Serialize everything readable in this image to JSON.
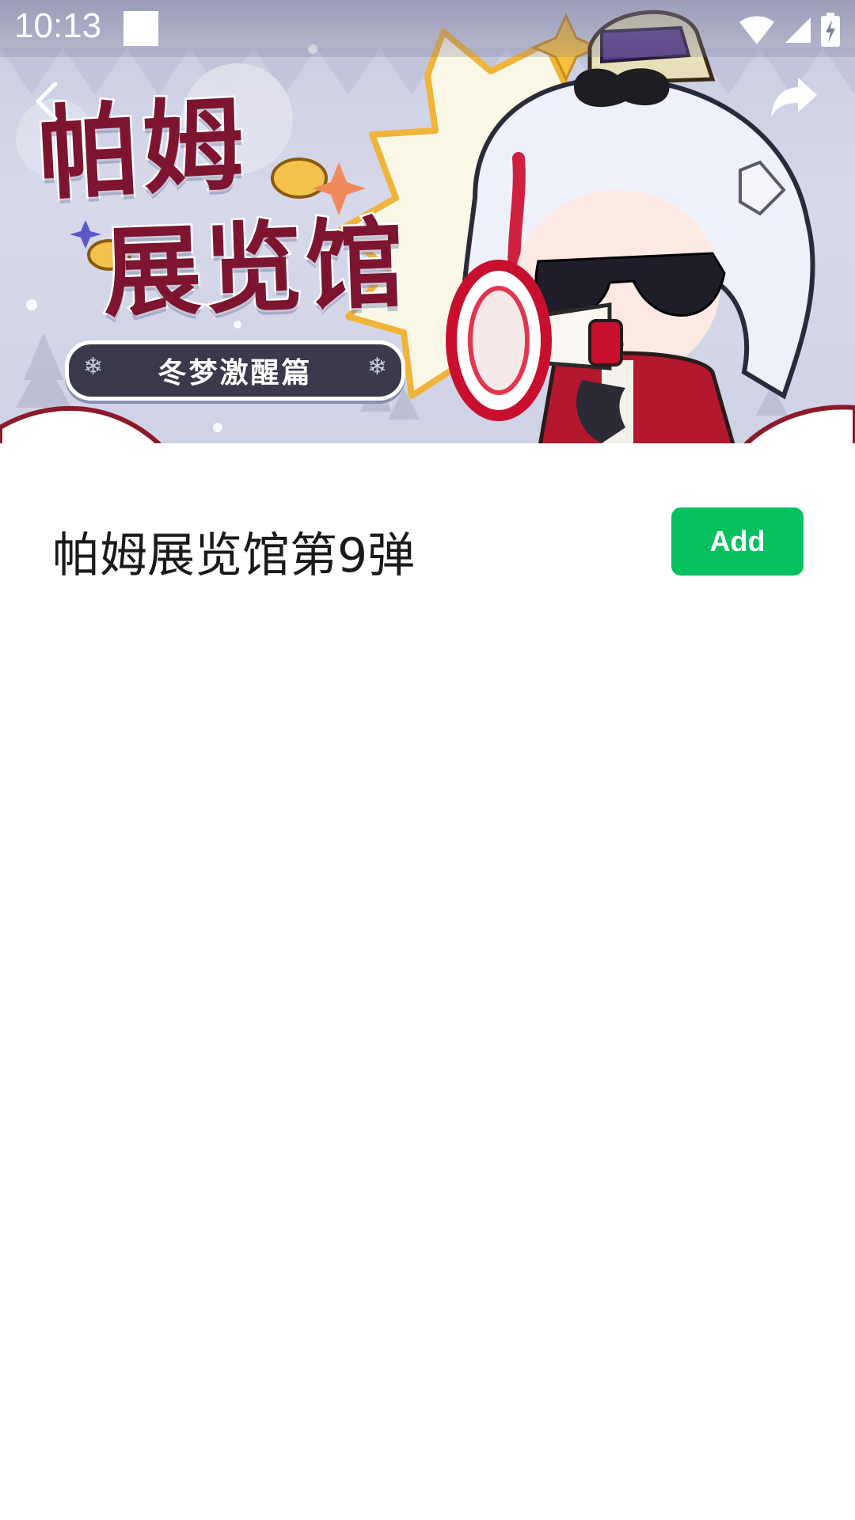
{
  "status_bar": {
    "time": "10:13"
  },
  "banner": {
    "title_line_1": "帕姆",
    "title_line_2": "展览馆",
    "subtitle": "冬梦激醒篇",
    "flake_glyph": "❄"
  },
  "nav": {
    "back_icon": "chevron-left-icon",
    "share_icon": "share-arrow-icon"
  },
  "item": {
    "title": "帕姆展览馆第9弹",
    "add_label": "Add"
  },
  "colors": {
    "accent_green": "#07c160",
    "title_maroon": "#7e1530",
    "pill_dark": "#3b3a4c"
  }
}
